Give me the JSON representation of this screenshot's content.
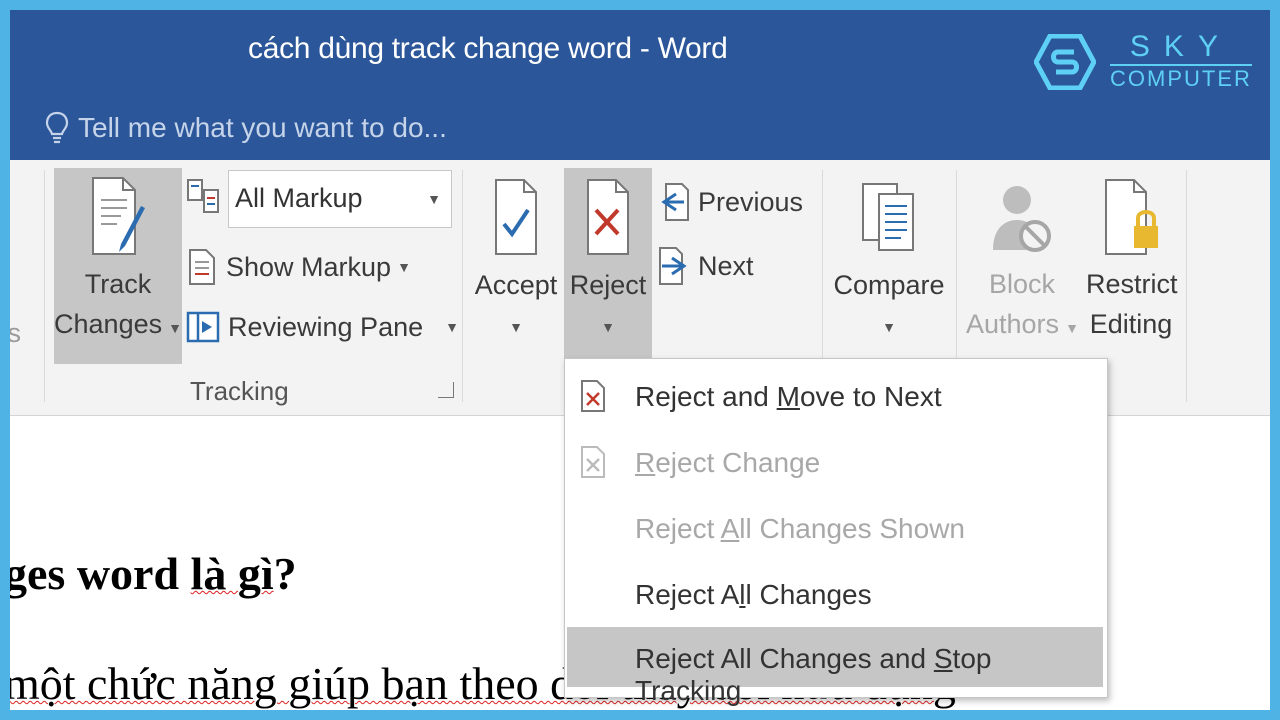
{
  "window": {
    "title": "cách dùng track change word - Word",
    "tell_me": "Tell me what you want to do..."
  },
  "brand": {
    "top": "SKY",
    "bottom": "COMPUTER"
  },
  "ribbon": {
    "partial_left": "ts",
    "track_changes": {
      "line1": "Track",
      "line2": "Changes"
    },
    "markup_dropdown": "All Markup",
    "show_markup": "Show Markup",
    "reviewing_pane": "Reviewing Pane",
    "tracking_label": "Tracking",
    "accept": "Accept",
    "reject": "Reject",
    "previous": "Previous",
    "next": "Next",
    "compare": "Compare",
    "block_authors": {
      "line1": "Block",
      "line2": "Authors"
    },
    "restrict_editing": {
      "line1": "Restrict",
      "line2": "Editing"
    }
  },
  "reject_menu": {
    "items": [
      {
        "pre": "Reject and ",
        "key": "M",
        "post": "ove to Next",
        "enabled": true
      },
      {
        "pre": "",
        "key": "R",
        "post": "eject Change",
        "enabled": false
      },
      {
        "pre": "Reject ",
        "key": "A",
        "post": "ll Changes Shown",
        "enabled": false
      },
      {
        "pre": "Reject A",
        "key": "l",
        "post": "l Changes",
        "enabled": true
      },
      {
        "pre": "Reject All Changes and ",
        "key": "S",
        "post": "top Tracking",
        "enabled": true,
        "highlighted": true
      }
    ]
  },
  "document": {
    "heading_a": "ges word ",
    "heading_b": "là gì",
    "heading_c": "?",
    "body_a": "một chức năng giúp bạn theo ",
    "body_b": "dõi thay đổi hữu dụng"
  }
}
